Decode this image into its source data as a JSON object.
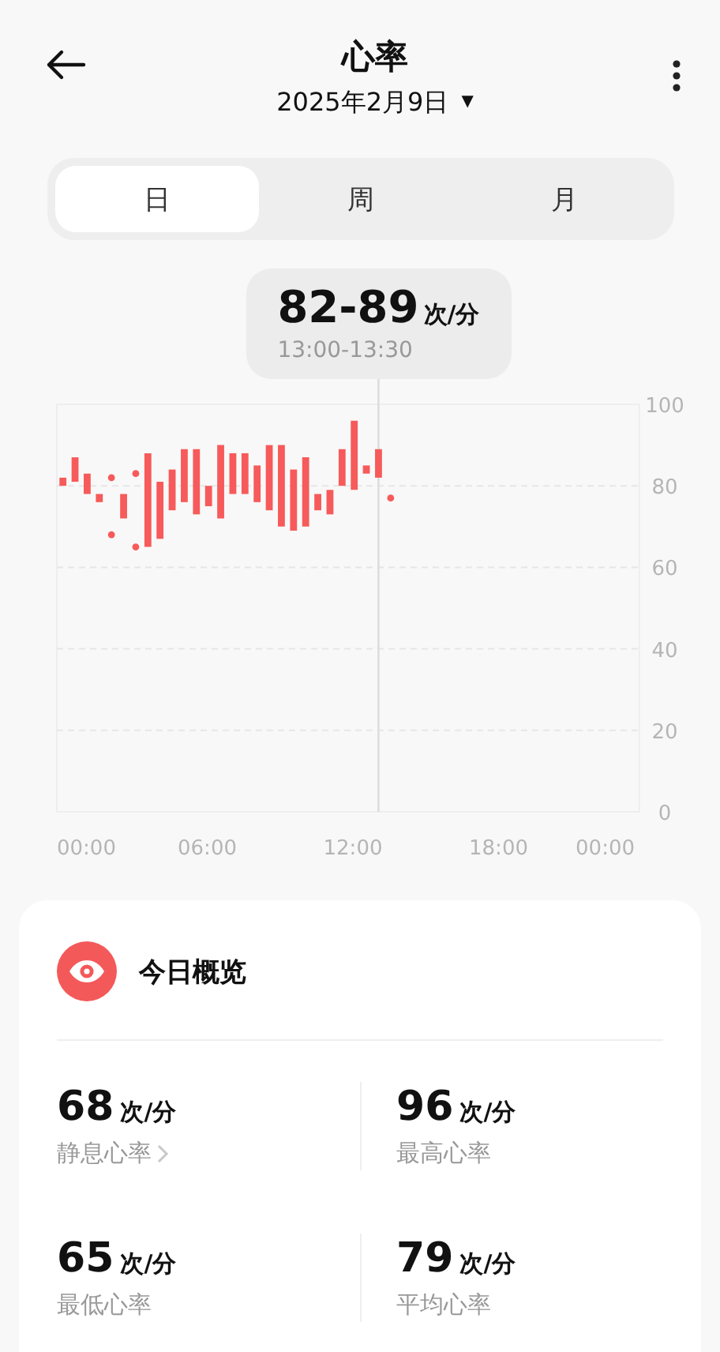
{
  "header": {
    "title": "心率",
    "date": "2025年2月9日",
    "date_caret": "▼"
  },
  "tabs": [
    {
      "label": "日",
      "selected": true
    },
    {
      "label": "周",
      "selected": false
    },
    {
      "label": "月",
      "selected": false
    }
  ],
  "chart": {
    "tooltip": {
      "value": "82-89",
      "unit": "次/分",
      "time": "13:00-13:30"
    },
    "y_axis_labels": [
      "100",
      "80",
      "60",
      "40",
      "20",
      "0"
    ],
    "x_axis_labels": [
      "00:00",
      "06:00",
      "12:00",
      "18:00",
      "00:00"
    ]
  },
  "summary": {
    "title": "今日概览",
    "stats": [
      {
        "value": "68",
        "unit": "次/分",
        "label": "静息心率",
        "has_arrow": true
      },
      {
        "value": "96",
        "unit": "次/分",
        "label": "最高心率",
        "has_arrow": false
      },
      {
        "value": "65",
        "unit": "次/分",
        "label": "最低心率",
        "has_arrow": false
      },
      {
        "value": "79",
        "unit": "次/分",
        "label": "平均心率",
        "has_arrow": false
      }
    ]
  }
}
